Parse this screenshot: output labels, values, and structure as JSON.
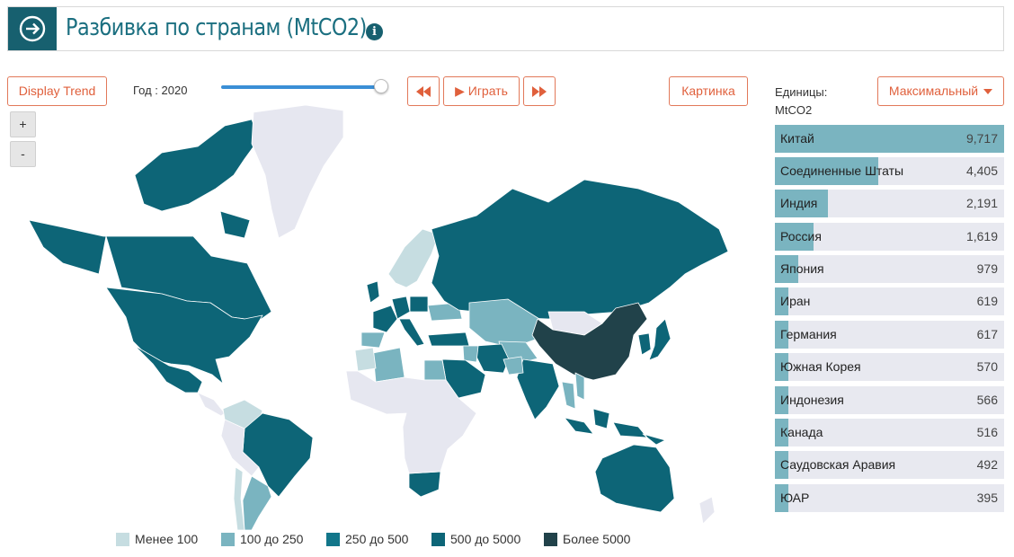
{
  "header": {
    "title": "Разбивка по странам (MtCO2)",
    "info_icon": "info-icon",
    "nav_icon": "arrow-right-circle-icon"
  },
  "controls": {
    "display_trend": "Display Trend",
    "year_label": "Год : 2020",
    "year_value": 2020,
    "rewind_icon": "rewind-icon",
    "play_label": "▶ Играть",
    "forward_icon": "fast-forward-icon",
    "image_label": "Картинка",
    "zoom_in": "+",
    "zoom_out": "-"
  },
  "units": {
    "label": "Единицы:",
    "value": "MtCO2",
    "dropdown_selected": "Максимальный"
  },
  "legend": [
    {
      "label": "Менее 100",
      "color": "#c6dde1"
    },
    {
      "label": "100 до 250",
      "color": "#7ab4c0"
    },
    {
      "label": "250 до 500",
      "color": "#12768a"
    },
    {
      "label": "500 до 5000",
      "color": "#0d6577"
    },
    {
      "label": "Более 5000",
      "color": "#21424a"
    }
  ],
  "colors": {
    "accent": "#e0603c",
    "brand": "#17606f",
    "bar_fill": "#7ab4c0",
    "bar_bg": "#e8e9f0",
    "no_data": "#e6e7f0"
  },
  "ranking": [
    {
      "name": "Китай",
      "value": 9717,
      "display": "9,717"
    },
    {
      "name": "Соединенные Штаты",
      "value": 4405,
      "display": "4,405"
    },
    {
      "name": "Индия",
      "value": 2191,
      "display": "2,191"
    },
    {
      "name": "Россия",
      "value": 1619,
      "display": "1,619"
    },
    {
      "name": "Япония",
      "value": 979,
      "display": "979"
    },
    {
      "name": "Иран",
      "value": 619,
      "display": "619"
    },
    {
      "name": "Германия",
      "value": 617,
      "display": "617"
    },
    {
      "name": "Южная Корея",
      "value": 570,
      "display": "570"
    },
    {
      "name": "Индонезия",
      "value": 566,
      "display": "566"
    },
    {
      "name": "Канада",
      "value": 516,
      "display": "516"
    },
    {
      "name": "Саудовская Аравия",
      "value": 492,
      "display": "492"
    },
    {
      "name": "ЮАР",
      "value": 395,
      "display": "395"
    }
  ],
  "map_regions": [
    {
      "name": "canada",
      "tier": 3
    },
    {
      "name": "greenland",
      "tier": -1
    },
    {
      "name": "usa",
      "tier": 3
    },
    {
      "name": "mexico",
      "tier": 3
    },
    {
      "name": "central-america",
      "tier": -1
    },
    {
      "name": "venezuela-colombia",
      "tier": 0
    },
    {
      "name": "brazil",
      "tier": 3
    },
    {
      "name": "peru-bolivia",
      "tier": -1
    },
    {
      "name": "argentina",
      "tier": 1
    },
    {
      "name": "chile",
      "tier": 0
    },
    {
      "name": "uk",
      "tier": 3
    },
    {
      "name": "france",
      "tier": 3
    },
    {
      "name": "spain",
      "tier": 1
    },
    {
      "name": "germany",
      "tier": 3
    },
    {
      "name": "poland",
      "tier": 3
    },
    {
      "name": "italy",
      "tier": 3
    },
    {
      "name": "scandinavia",
      "tier": 0
    },
    {
      "name": "ukraine",
      "tier": 1
    },
    {
      "name": "turkey",
      "tier": 3
    },
    {
      "name": "russia",
      "tier": 3
    },
    {
      "name": "kazakhstan",
      "tier": 1
    },
    {
      "name": "central-asia",
      "tier": 1
    },
    {
      "name": "mongolia",
      "tier": -1
    },
    {
      "name": "china",
      "tier": 4
    },
    {
      "name": "korea",
      "tier": 3
    },
    {
      "name": "japan",
      "tier": 3
    },
    {
      "name": "iran",
      "tier": 3
    },
    {
      "name": "iraq",
      "tier": 1
    },
    {
      "name": "saudi-arabia",
      "tier": 3
    },
    {
      "name": "egypt",
      "tier": 1
    },
    {
      "name": "algeria",
      "tier": 1
    },
    {
      "name": "morocco",
      "tier": 0
    },
    {
      "name": "india",
      "tier": 3
    },
    {
      "name": "pakistan",
      "tier": 1
    },
    {
      "name": "thailand",
      "tier": 1
    },
    {
      "name": "vietnam",
      "tier": 1
    },
    {
      "name": "indonesia",
      "tier": 3
    },
    {
      "name": "australia",
      "tier": 3
    },
    {
      "name": "new-zealand",
      "tier": -1
    },
    {
      "name": "south-africa",
      "tier": 3
    },
    {
      "name": "nigeria",
      "tier": 0
    },
    {
      "name": "africa-rest",
      "tier": -1
    }
  ]
}
